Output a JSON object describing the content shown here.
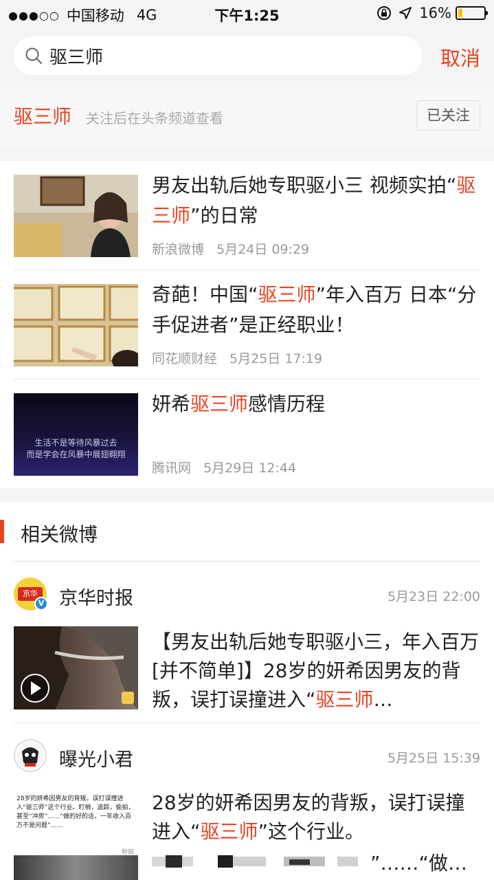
{
  "status_bar": {
    "signal": "●●●○○",
    "carrier": "中国移动",
    "network": "4G",
    "time": "下午1:25",
    "battery_percent": "16%",
    "battery_level": 0.16
  },
  "search": {
    "query": "驱三师",
    "cancel_label": "取消"
  },
  "subscribe": {
    "keyword": "驱三师",
    "hint": "关注后在头条频道查看",
    "button_label": "已关注"
  },
  "news": [
    {
      "title_before": "男友出轨后她专职驱小三 视频实拍“",
      "title_highlight": "驱三师",
      "title_after": "”的日常",
      "source": "新浪微博",
      "date": "5月24日 09:29"
    },
    {
      "title_before": "奇葩！中国“",
      "title_highlight": "驱三师",
      "title_after": "”年入百万 日本“分手促进者”是正经职业！",
      "source": "同花顺财经",
      "date": "5月25日 17:19"
    },
    {
      "title_before": "妍希",
      "title_highlight": "驱三师",
      "title_after": "感情历程",
      "source": "腾讯网",
      "date": "5月29日 12:44",
      "thumb_caption_1": "生活不是等待风暴过去",
      "thumb_caption_2": "而是学会在风暴中展翅翱翔"
    }
  ],
  "related": {
    "section_title": "相关微博",
    "posts": [
      {
        "author": "京华时报",
        "avatar_text": "京华",
        "verified_mark": "V",
        "time": "5月23日 22:00",
        "text_before": "【男友出轨后她专职驱小三，年入百万[并不简单]】28岁的妍希因男友的背叛，误打误撞进入“",
        "text_highlight": "驱三师",
        "text_after": "…"
      },
      {
        "author": "曝光小君",
        "time": "5月25日 15:39",
        "text_before": "28岁的妍希因男友的背叛，误打误撞进入“",
        "text_highlight": "驱三师",
        "text_after": "”这个行业。",
        "text_tail": "”……“做…",
        "thumb_text": "28岁的妍希因男友的背叛，误打误撞进入“驱三师”这个行业。盯梢，追踪，偷拍，甚至“冲房”……“做的好的话，一年收入百万不是问题”……",
        "thumb_badge": "秒拍"
      }
    ]
  },
  "colors": {
    "accent": "#e8431f",
    "background": "#f4f4f4",
    "meta_gray": "#999999"
  }
}
